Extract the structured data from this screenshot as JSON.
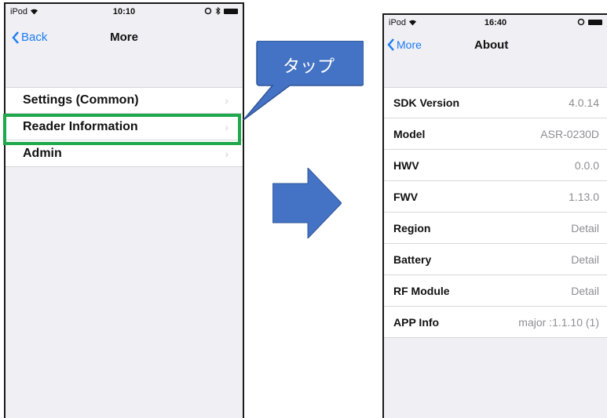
{
  "left_screen": {
    "status": {
      "carrier": "iPod",
      "time": "10:10"
    },
    "nav": {
      "back_label": "Back",
      "title": "More"
    },
    "items": [
      {
        "label": "Settings (Common)"
      },
      {
        "label": "Reader Information"
      },
      {
        "label": "Admin"
      }
    ]
  },
  "callout": {
    "text": "タップ"
  },
  "right_screen": {
    "status": {
      "carrier": "iPod",
      "time": "16:40"
    },
    "nav": {
      "back_label": "More",
      "title": "About"
    },
    "rows": [
      {
        "label": "SDK Version",
        "value": "4.0.14"
      },
      {
        "label": "Model",
        "value": "ASR-0230D"
      },
      {
        "label": "HWV",
        "value": "0.0.0"
      },
      {
        "label": "FWV",
        "value": "1.13.0"
      },
      {
        "label": "Region",
        "value": "Detail"
      },
      {
        "label": "Battery",
        "value": "Detail"
      },
      {
        "label": "RF Module",
        "value": "Detail"
      },
      {
        "label": "APP Info",
        "value": "major :1.1.10 (1)"
      }
    ]
  },
  "colors": {
    "ios_blue": "#1b7bf5",
    "highlight_green": "#1fa84c",
    "callout_blue": "#4472c4",
    "arrow_blue": "#4472c4"
  }
}
